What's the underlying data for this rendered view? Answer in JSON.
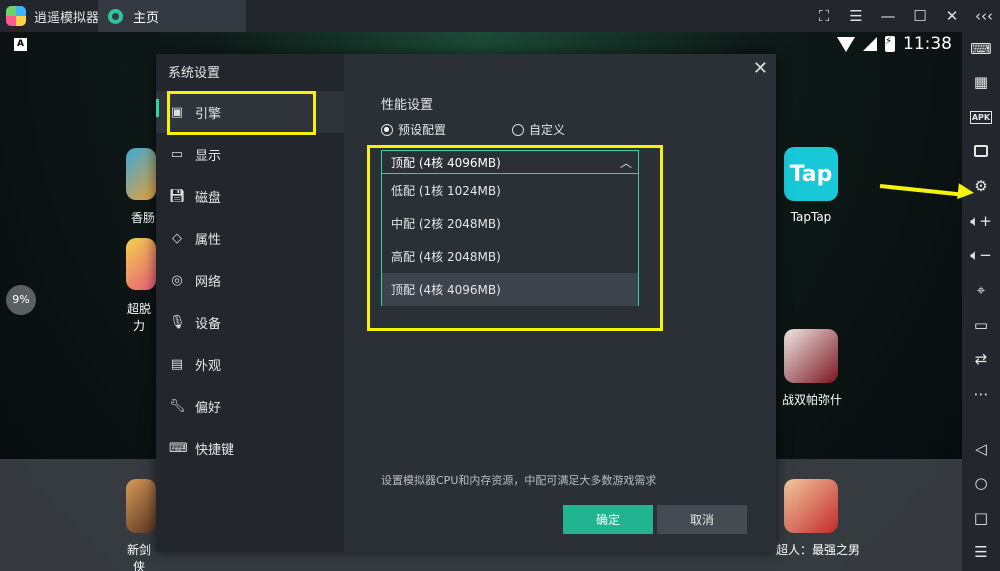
{
  "titlebar": {
    "app_title": "逍遥模拟器",
    "tab_home": "主页",
    "controls": [
      "⛶",
      "☰",
      "—",
      "☐",
      "✕",
      "‹‹‹"
    ]
  },
  "statusbar": {
    "left_badge": "A",
    "clock": "11:38"
  },
  "desktop": {
    "progress_badge": "9%",
    "apps": [
      {
        "label": "香肠派对",
        "visible_label": "香肠"
      },
      {
        "label": "超脱力",
        "visible_label": "超脱力"
      },
      {
        "label": "TapTap"
      },
      {
        "label": "战双帕弥什"
      },
      {
        "label": "新剑侠情缘",
        "visible_label": "新剑侠"
      },
      {
        "label": "一拳超人：最强之男",
        "visible_label": "超人：最强之男"
      }
    ],
    "taptap_text": "Tap"
  },
  "dialog": {
    "title": "系统设置",
    "close": "✕",
    "nav": [
      {
        "label": "引擎",
        "icon": "engine-icon"
      },
      {
        "label": "显示",
        "icon": "monitor-icon"
      },
      {
        "label": "磁盘",
        "icon": "disk-icon"
      },
      {
        "label": "属性",
        "icon": "tag-icon"
      },
      {
        "label": "网络",
        "icon": "globe-icon"
      },
      {
        "label": "设备",
        "icon": "mic-icon"
      },
      {
        "label": "外观",
        "icon": "window-icon"
      },
      {
        "label": "偏好",
        "icon": "wrench-icon"
      },
      {
        "label": "快捷键",
        "icon": "keyboard-icon"
      }
    ],
    "section_title": "性能设置",
    "radio_preset": "预设配置",
    "radio_custom": "自定义",
    "selected": "顶配 (4核 4096MB)",
    "options": [
      "低配 (1核 1024MB)",
      "中配 (2核 2048MB)",
      "高配 (4核 2048MB)",
      "顶配 (4核 4096MB)"
    ],
    "hint": "设置模拟器CPU和内存资源，中配可满足大多数游戏需求",
    "ok": "确定",
    "cancel": "取消"
  },
  "rightbar": {
    "apk": "APK"
  },
  "colors": {
    "accent": "#2fd1a6",
    "ok_button": "#22b490",
    "highlight": "#f6f20a"
  }
}
